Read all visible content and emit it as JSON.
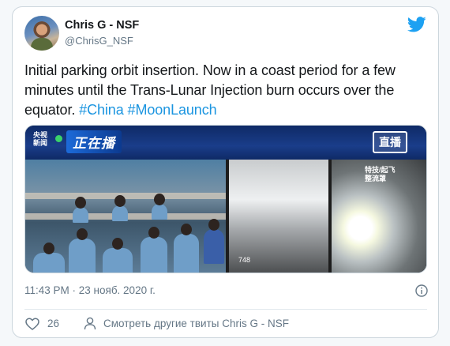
{
  "author": {
    "display_name": "Chris G - NSF",
    "handle": "@ChrisG_NSF"
  },
  "tweet": {
    "text_plain": "Initial parking orbit insertion.  Now in a coast period for a few minutes until the Trans-Lunar Injection burn occurs over the equator.",
    "hashtags": [
      "#China",
      "#MoonLaunch"
    ]
  },
  "media": {
    "channel_logo_line1": "央视",
    "channel_logo_line2": "新闻",
    "program_title": "正在播",
    "live_label": "直播",
    "camera_label_line1": "特技/起飞",
    "camera_label_line2": "整流罩",
    "camera_number": "748"
  },
  "meta": {
    "timestamp": "11:43 PM · 23 нояб. 2020 г."
  },
  "actions": {
    "like_count": "26",
    "more_tweets_label": "Смотреть другие твиты Chris G - NSF"
  },
  "colors": {
    "link": "#1b95e0",
    "muted": "#657786",
    "twitter_blue": "#1da1f2"
  },
  "icons": {
    "brand": "twitter-bird-icon",
    "info": "info-icon",
    "like": "heart-icon",
    "profile": "user-icon"
  }
}
